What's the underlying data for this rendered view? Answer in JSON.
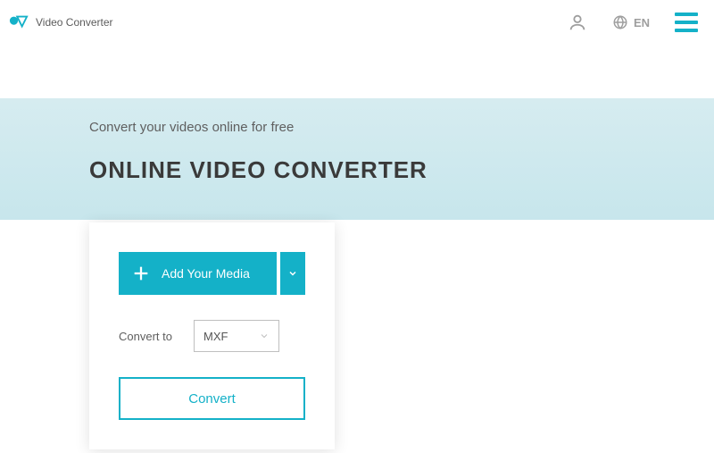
{
  "header": {
    "brand": "Video Converter",
    "language": "EN"
  },
  "hero": {
    "subtitle": "Convert your videos online for free",
    "title": "ONLINE VIDEO CONVERTER"
  },
  "card": {
    "add_label": "Add Your Media",
    "convert_to_label": "Convert to",
    "format_selected": "MXF",
    "convert_button": "Convert"
  }
}
